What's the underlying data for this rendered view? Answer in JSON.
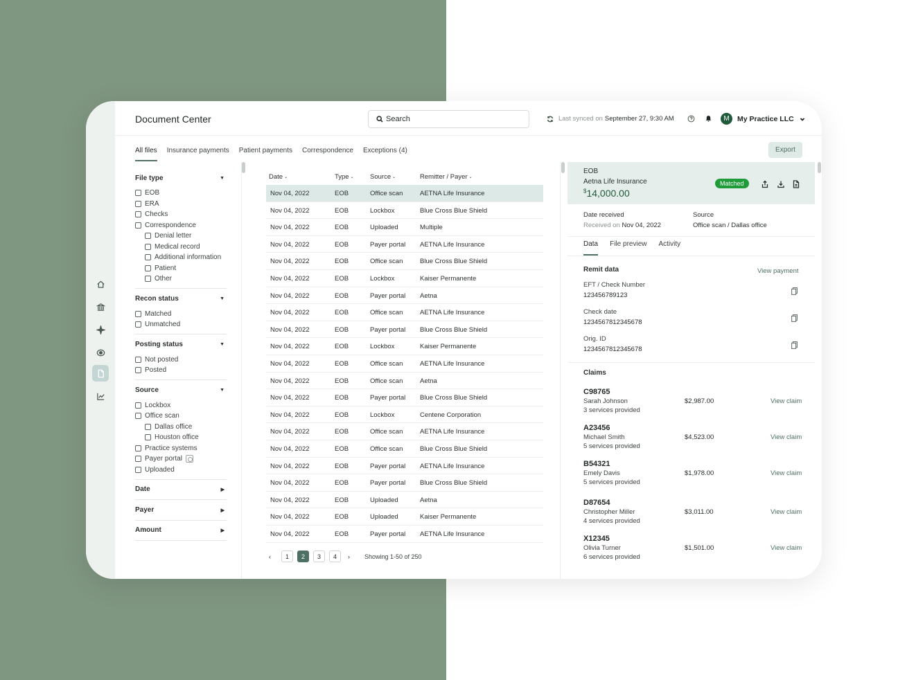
{
  "app": {
    "title": "Document Center"
  },
  "search": {
    "placeholder": "Search"
  },
  "sync": {
    "prefix": "Last synced on",
    "time": "September 27, 9:30 AM"
  },
  "user": {
    "initial": "M",
    "org": "My Practice LLC"
  },
  "rail": [
    "home-icon",
    "bank-icon",
    "sparkle-icon",
    "eye-icon",
    "document-icon",
    "chart-icon"
  ],
  "tabs": [
    "All files",
    "Insurance payments",
    "Patient payments",
    "Correspondence",
    "Exceptions (4)"
  ],
  "export_label": "Export",
  "filters": {
    "file_type": {
      "title": "File type",
      "items": [
        "EOB",
        "ERA",
        "Checks",
        "Correspondence"
      ],
      "sub": [
        "Denial letter",
        "Medical record",
        "Additional information",
        "Patient",
        "Other"
      ]
    },
    "recon": {
      "title": "Recon status",
      "items": [
        "Matched",
        "Unmatched"
      ]
    },
    "posting": {
      "title": "Posting status",
      "items": [
        "Not posted",
        "Posted"
      ]
    },
    "source": {
      "title": "Source",
      "items": [
        "Lockbox",
        "Office scan"
      ],
      "sub": [
        "Dallas office",
        "Houston office"
      ],
      "items2": [
        "Practice systems",
        "Payer portal",
        "Uploaded"
      ]
    },
    "collapsed": [
      "Date",
      "Payer",
      "Amount"
    ]
  },
  "table": {
    "headers": [
      "Date",
      "Type",
      "Source",
      "Remitter / Payer"
    ],
    "rows": [
      [
        "Nov 04, 2022",
        "EOB",
        "Office scan",
        "AETNA Life Insurance"
      ],
      [
        "Nov 04, 2022",
        "EOB",
        "Lockbox",
        "Blue Cross Blue Shield"
      ],
      [
        "Nov 04, 2022",
        "EOB",
        "Uploaded",
        "Multiple"
      ],
      [
        "Nov 04, 2022",
        "EOB",
        "Payer portal",
        "AETNA Life Insurance"
      ],
      [
        "Nov 04, 2022",
        "EOB",
        "Office scan",
        "Blue Cross Blue Shield"
      ],
      [
        "Nov 04, 2022",
        "EOB",
        "Lockbox",
        "Kaiser Permanente"
      ],
      [
        "Nov 04, 2022",
        "EOB",
        "Payer portal",
        "Aetna"
      ],
      [
        "Nov 04, 2022",
        "EOB",
        "Office scan",
        "AETNA Life Insurance"
      ],
      [
        "Nov 04, 2022",
        "EOB",
        "Payer portal",
        "Blue Cross Blue Shield"
      ],
      [
        "Nov 04, 2022",
        "EOB",
        "Lockbox",
        "Kaiser Permanente"
      ],
      [
        "Nov 04, 2022",
        "EOB",
        "Office scan",
        "AETNA Life Insurance"
      ],
      [
        "Nov 04, 2022",
        "EOB",
        "Office scan",
        "Aetna"
      ],
      [
        "Nov 04, 2022",
        "EOB",
        "Payer portal",
        "Blue Cross Blue Shield"
      ],
      [
        "Nov 04, 2022",
        "EOB",
        "Lockbox",
        "Centene Corporation"
      ],
      [
        "Nov 04, 2022",
        "EOB",
        "Office scan",
        "AETNA Life Insurance"
      ],
      [
        "Nov 04, 2022",
        "EOB",
        "Office scan",
        "Blue Cross Blue Shield"
      ],
      [
        "Nov 04, 2022",
        "EOB",
        "Payer portal",
        "AETNA Life Insurance"
      ],
      [
        "Nov 04, 2022",
        "EOB",
        "Payer portal",
        "Blue Cross Blue Shield"
      ],
      [
        "Nov 04, 2022",
        "EOB",
        "Uploaded",
        "Aetna"
      ],
      [
        "Nov 04, 2022",
        "EOB",
        "Uploaded",
        "Kaiser Permanente"
      ],
      [
        "Nov 04, 2022",
        "EOB",
        "Payer portal",
        "AETNA Life Insurance"
      ]
    ],
    "selected_row": 0
  },
  "pager": {
    "pages": [
      "1",
      "2",
      "3",
      "4"
    ],
    "current": "2",
    "info": "Showing 1-50 of 250",
    "prev": "‹",
    "next": "›"
  },
  "detail": {
    "type": "EOB",
    "payer": "Aetna Life Insurance",
    "currency": "$",
    "amount": "14,000.00",
    "status": "Matched",
    "date_label": "Date received",
    "date_prefix": "Received on",
    "date_value": "Nov 04, 2022",
    "source_label": "Source",
    "source_value": "Office scan / Dallas office",
    "tabs": [
      "Data",
      "File preview",
      "Activity"
    ],
    "remit_title": "Remit data",
    "view_payment": "View payment",
    "fields": [
      {
        "label": "EFT / Check Number",
        "value": "123456789123"
      },
      {
        "label": "Check date",
        "value": "1234567812345678"
      },
      {
        "label": "Orig. ID",
        "value": "1234567812345678"
      }
    ],
    "claims_title": "Claims",
    "view_claim": "View claim",
    "claims": [
      {
        "id": "C98765",
        "name": "Sarah Johnson",
        "services": "3 services provided",
        "amount": "$2,987.00"
      },
      {
        "id": "A23456",
        "name": "Michael Smith",
        "services": "5 services provided",
        "amount": "$4,523.00"
      },
      {
        "id": "B54321",
        "name": "Emely Davis",
        "services": "5 services provided",
        "amount": "$1,978.00"
      },
      {
        "id": "D87654",
        "name": "Christopher Miller",
        "services": "4 services provided",
        "amount": "$3,011.00"
      },
      {
        "id": "X12345",
        "name": "Olivia Turner",
        "services": "6 services provided",
        "amount": "$1,501.00"
      }
    ]
  },
  "colors": {
    "accent": "#4e6f63",
    "matched": "#1f9b3a",
    "backdrop": "#7f9681"
  }
}
